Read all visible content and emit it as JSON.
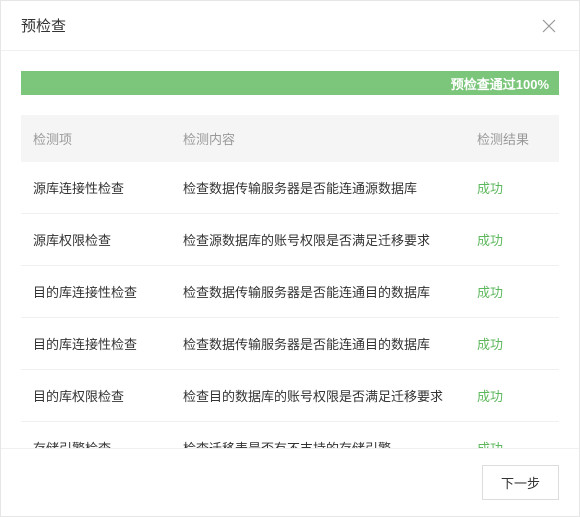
{
  "header": {
    "title": "预检查"
  },
  "progress": {
    "text": "预检查通过100%"
  },
  "table": {
    "headers": {
      "item": "检测项",
      "content": "检测内容",
      "result": "检测结果"
    },
    "rows": [
      {
        "item": "源库连接性检查",
        "content": "检查数据传输服务器是否能连通源数据库",
        "result": "成功"
      },
      {
        "item": "源库权限检查",
        "content": "检查源数据库的账号权限是否满足迁移要求",
        "result": "成功"
      },
      {
        "item": "目的库连接性检查",
        "content": "检查数据传输服务器是否能连通目的数据库",
        "result": "成功"
      },
      {
        "item": "目的库连接性检查",
        "content": "检查数据传输服务器是否能连通目的数据库",
        "result": "成功"
      },
      {
        "item": "目的库权限检查",
        "content": "检查目的数据库的账号权限是否满足迁移要求",
        "result": "成功"
      },
      {
        "item": "存储引擎检查",
        "content": "检查迁移表是否有不支持的存储引擎",
        "result": "成功"
      }
    ]
  },
  "footer": {
    "next": "下一步"
  }
}
